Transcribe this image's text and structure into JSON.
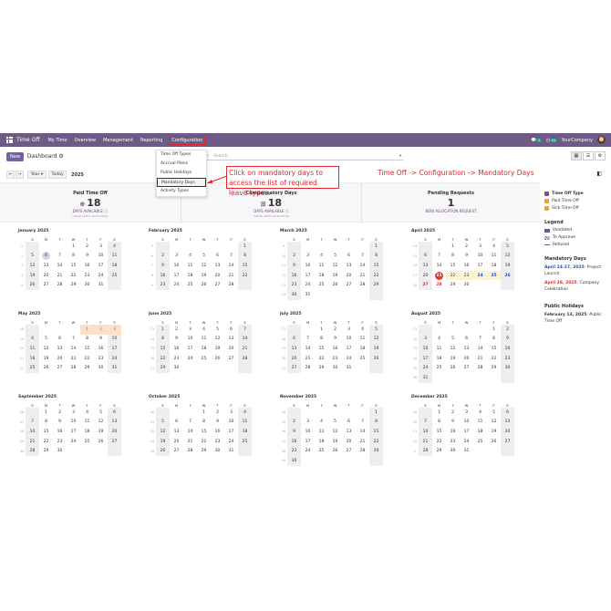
{
  "navbar": {
    "app_name": "Time Off",
    "menus": [
      "My Time",
      "Overview",
      "Management",
      "Reporting",
      "Configuration"
    ],
    "badge_chat": "1",
    "badge_activity": "15",
    "company": "YourCompany"
  },
  "control": {
    "new_label": "New",
    "breadcrumb": "Dashboard ⚙",
    "search_placeholder": "Search...",
    "year_label": "Year ▾",
    "today_label": "Today",
    "year": "2025"
  },
  "dropdown": {
    "items": [
      "Time Off Types",
      "Accrual Plans",
      "Public Holidays",
      "Mandatory Days",
      "Activity Types"
    ]
  },
  "annotations": {
    "box_text": "Click on mandatory days to access the list of required leave types.",
    "path_text": "Time Off -> Configuration -> Mandatory Days"
  },
  "summary": {
    "paid": {
      "title": "Paid Time Off",
      "value": "18",
      "sub": "DAYS AVAILABLE ⓘ",
      "valid": "(VALID UNTIL 12/31/2025)"
    },
    "comp": {
      "title": "Compensatory Days",
      "value": "18",
      "sub": "DAYS AVAILABLE ⓘ",
      "valid": "(VALID UNTIL 12/31/2025)"
    },
    "pending": {
      "title": "Pending Requests",
      "value": "1",
      "sub": "NEW ALLOCATION REQUEST"
    }
  },
  "weekday_headers": [
    "S",
    "M",
    "T",
    "W",
    "T",
    "F",
    "S"
  ],
  "months": [
    {
      "name": "January 2025",
      "weeks": [
        "1",
        "2",
        "3",
        "4",
        "5"
      ],
      "start": 3,
      "days": 31,
      "today": 6
    },
    {
      "name": "February 2025",
      "weeks": [
        "5",
        "6",
        "7",
        "8",
        "9"
      ],
      "start": 6,
      "days": 28
    },
    {
      "name": "March 2025",
      "weeks": [
        "9",
        "10",
        "11",
        "12",
        "13",
        "14"
      ],
      "start": 6,
      "days": 31
    },
    {
      "name": "April 2025",
      "weeks": [
        "14",
        "15",
        "16",
        "17",
        "18"
      ],
      "start": 2,
      "days": 30,
      "red": [
        21
      ],
      "blue": [
        24,
        25,
        26
      ],
      "pubred": [
        27,
        28
      ],
      "striped": [
        22,
        23,
        24,
        25
      ]
    },
    {
      "name": "May 2025",
      "weeks": [
        "18",
        "19",
        "20",
        "21",
        "22"
      ],
      "start": 4,
      "days": 31,
      "mandatory": [
        1,
        2,
        3
      ]
    },
    {
      "name": "June 2025",
      "weeks": [
        "23",
        "24",
        "25",
        "26",
        "27"
      ],
      "start": 0,
      "days": 30
    },
    {
      "name": "July 2025",
      "weeks": [
        "27",
        "28",
        "29",
        "30",
        "31"
      ],
      "start": 2,
      "days": 31
    },
    {
      "name": "August 2025",
      "weeks": [
        "31",
        "32",
        "33",
        "34",
        "35",
        "36"
      ],
      "start": 5,
      "days": 31
    },
    {
      "name": "September 2025",
      "weeks": [
        "36",
        "37",
        "38",
        "39",
        "40"
      ],
      "start": 1,
      "days": 30
    },
    {
      "name": "October 2025",
      "weeks": [
        "40",
        "41",
        "42",
        "43",
        "44"
      ],
      "start": 3,
      "days": 31
    },
    {
      "name": "November 2025",
      "weeks": [
        "44",
        "45",
        "46",
        "47",
        "48",
        "49"
      ],
      "start": 6,
      "days": 30
    },
    {
      "name": "December 2025",
      "weeks": [
        "49",
        "50",
        "51",
        "52",
        "1"
      ],
      "start": 1,
      "days": 31
    }
  ],
  "sidebar": {
    "types_title": "Time Off Type",
    "types": [
      {
        "label": "Time Off Type",
        "color": "#6d5b86"
      },
      {
        "label": "Paid Time Off",
        "color": "#e8a33d"
      },
      {
        "label": "Sick Time Off",
        "color": "#e8a33d"
      }
    ],
    "legend_title": "Legend",
    "legend": [
      "Validated",
      "To Approve",
      "Refused"
    ],
    "mandatory_title": "Mandatory Days",
    "mandatory": [
      {
        "date": "April 24-27, 2025",
        "text": ": Project Launch"
      },
      {
        "date": "April 28, 2025",
        "text": ": Company Celebration"
      }
    ],
    "public_title": "Public Holidays",
    "public": [
      {
        "date": "February 13, 2025",
        "text": ": Public Time Off"
      }
    ]
  }
}
